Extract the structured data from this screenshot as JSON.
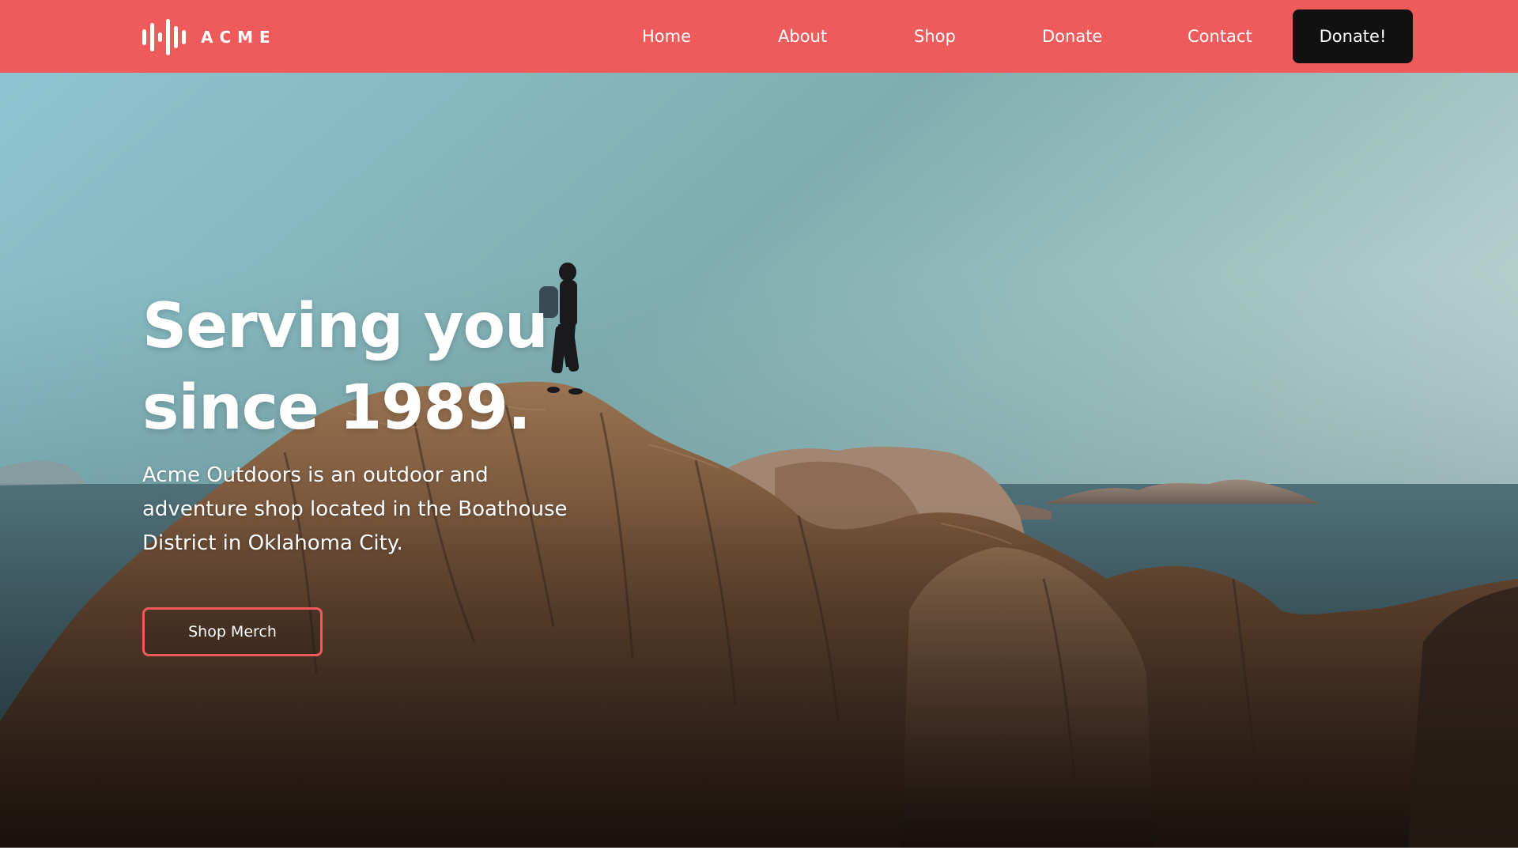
{
  "brand": {
    "name": "ACME",
    "logo_icon": "sound-wave-icon",
    "accent_color": "#ef5a5a",
    "dark_color": "#111111"
  },
  "nav": {
    "links": [
      "Home",
      "About",
      "Shop",
      "Donate",
      "Contact"
    ],
    "cta_label": "Donate!"
  },
  "hero": {
    "title_line1": "Serving you",
    "title_line2": "since 1989.",
    "description": "Acme Outdoors is an outdoor and adventure shop located in the Boathouse District in Oklahoma City.",
    "button_label": "Shop Merch",
    "background": "hiker-on-coastal-rocks-photo"
  }
}
